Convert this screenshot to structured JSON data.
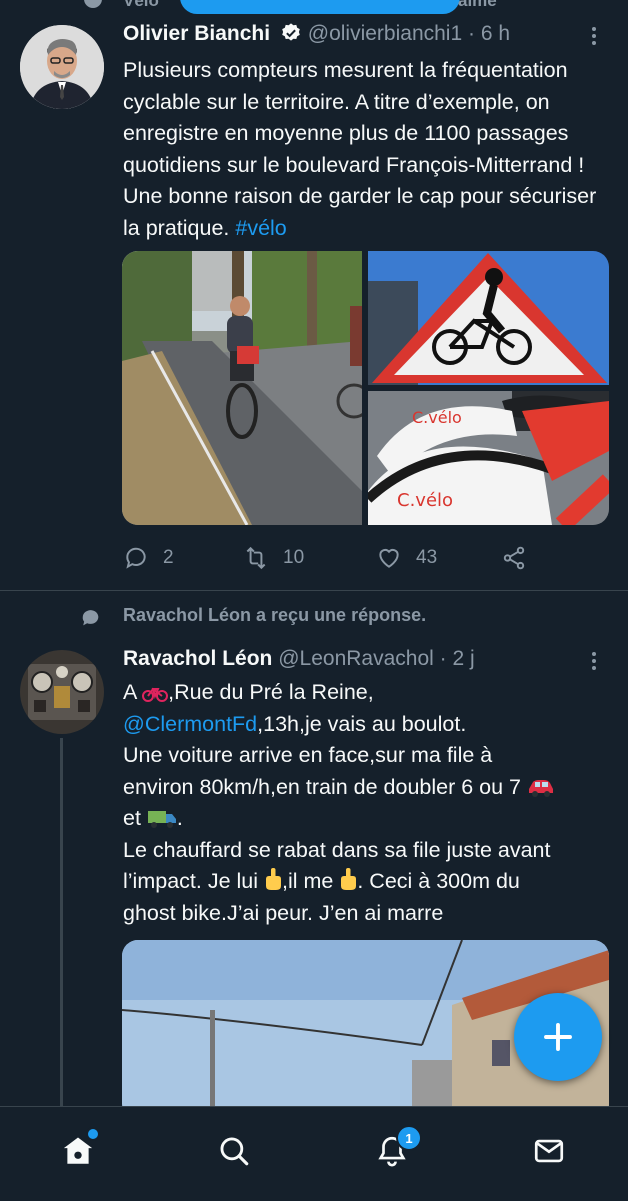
{
  "colors": {
    "background": "#15202b",
    "accent": "#1d9bf0",
    "muted": "#8b98a5",
    "divider": "#38444d"
  },
  "top_context": {
    "left_text": "Vélo",
    "right_text": "aime"
  },
  "tweets": [
    {
      "name": "Olivier Bianchi",
      "handle": "@olivierbianchi1",
      "time": "· 6 h",
      "verified": true,
      "text": "Plusieurs compteurs mesurent la fréquentation cyclable sur le territoire. A titre d’exemple, on enregistre en moyenne plus de 1100 passages quotidiens sur le boulevard François-Mitterrand ! Une bonne raison de garder le cap pour sécuriser la pratique. ",
      "hashtag": "#vélo",
      "media": [
        {
          "name": "cyclist-bike-lane-photo"
        },
        {
          "name": "bicycle-warning-sign-photo"
        },
        {
          "name": "cvelo-bike-photo",
          "labels": [
            "C.vélo",
            "C.vélo"
          ]
        }
      ],
      "stats": {
        "replies": "2",
        "retweets": "10",
        "likes": "43"
      }
    },
    {
      "social_context": "Ravachol Léon a reçu une réponse.",
      "name": "Ravachol Léon",
      "handle": "@LeonRavachol",
      "time": "· 2 j",
      "lines": {
        "l1a": "A ",
        "l1b": ",Rue du Pré la Reine,",
        "mention": "@ClermontFd",
        "l2": ",13h,je vais au boulot.",
        "l3": "Une voiture arrive en face,sur ma file à",
        "l4": "environ 80km/h,en train de doubler 6 ou 7 ",
        "l5": "et ",
        "l5b": ".",
        "l6": "Le chauffard se rabat dans sa file juste avant",
        "l7a": "l’impact. Je lui ",
        "l7b": ",il me ",
        "l7c": ". Ceci à 300m du",
        "l8": "ghost bike.J’ai peur. J’en ai marre"
      }
    }
  ],
  "bottom_nav": {
    "notifications_badge": "1",
    "items": [
      "home-icon",
      "search-icon",
      "notifications-icon",
      "messages-icon"
    ]
  },
  "fab": {
    "label": "+"
  }
}
